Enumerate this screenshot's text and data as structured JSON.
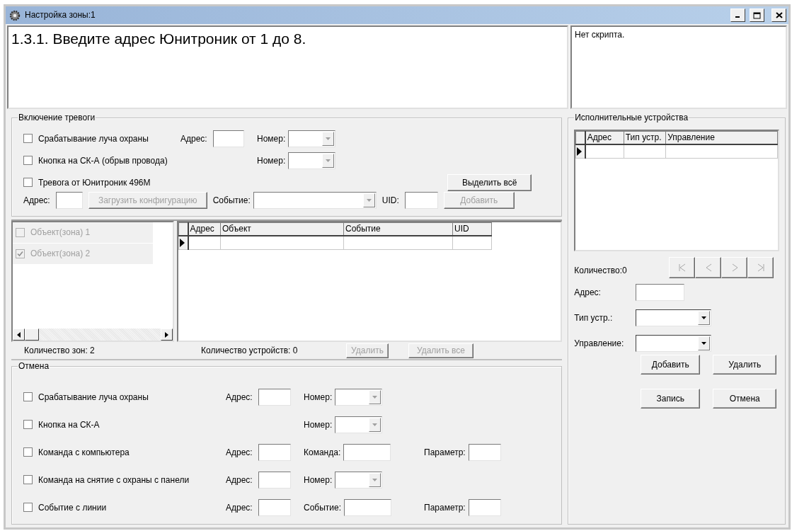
{
  "window": {
    "title": "Настройка зоны:1"
  },
  "instruction": "1.3.1. Введите адрес Юнитроник от 1 до 8.",
  "script_info": "Нет скрипта.",
  "alarm": {
    "title": "Включение тревоги",
    "rows": [
      {
        "check": {
          "label": "Срабатывание луча охраны",
          "checked": false
        },
        "address": {
          "label": "Адрес:"
        },
        "number": {
          "label": "Номер:",
          "disabled": true
        }
      },
      {
        "check": {
          "label": "Кнопка на СК-А (обрыв провода)",
          "checked": false
        },
        "number": {
          "label": "Номер:",
          "disabled": true
        }
      },
      {
        "check": {
          "label": "Тревога от Юнитроник 496М",
          "checked": false
        },
        "button": {
          "label": "Выделить всё",
          "disabled": false
        }
      }
    ],
    "source": {
      "address_label": "Адрес:",
      "load_button": {
        "label": "Загрузить конфигурацию",
        "disabled": true
      },
      "event_label": "Событие:",
      "uid_label": "UID:",
      "add_button": {
        "label": "Добавить",
        "disabled": true
      }
    }
  },
  "zones": {
    "items": [
      {
        "label": "Объект(зона) 1",
        "checked": false,
        "disabled": true
      },
      {
        "label": "Объект(зона) 2",
        "checked": true,
        "disabled": true
      }
    ]
  },
  "events_table": {
    "columns": [
      "Адрес",
      "Объект",
      "Событие",
      "UID"
    ]
  },
  "status": {
    "zones_count": "Количество зон: 2",
    "devices_count": "Количество устройств: 0",
    "buttons": [
      {
        "label": "Удалить",
        "disabled": true
      },
      {
        "label": "Удалить все",
        "disabled": true
      }
    ]
  },
  "cancel": {
    "title": "Отмена",
    "rows": [
      {
        "check": {
          "label": "Срабатывание луча охраны",
          "checked": false
        },
        "address": {
          "label": "Адрес:"
        },
        "second": {
          "kind": "combo",
          "label": "Номер:",
          "disabled": true
        }
      },
      {
        "check": {
          "label": "Кнопка на СК-А",
          "checked": false
        },
        "second": {
          "kind": "combo",
          "label": "Номер:",
          "disabled": true
        }
      },
      {
        "check": {
          "label": "Команда с компьютера",
          "checked": false
        },
        "address": {
          "label": "Адрес:"
        },
        "second": {
          "kind": "input",
          "label": "Команда:"
        },
        "third": {
          "label": "Параметр:"
        }
      },
      {
        "check": {
          "label": "Команда на снятие с охраны с панели",
          "checked": false
        },
        "address": {
          "label": "Адрес:"
        },
        "second": {
          "kind": "combo",
          "label": "Номер:",
          "disabled": true
        }
      },
      {
        "check": {
          "label": "Событие с линии",
          "checked": false
        },
        "address": {
          "label": "Адрес:"
        },
        "second": {
          "kind": "input",
          "label": "Событие:"
        },
        "third": {
          "label": "Параметр:"
        }
      }
    ]
  },
  "devices": {
    "title": "Исполнительные устройства",
    "columns": [
      "Адрес",
      "Тип устр.",
      "Управление"
    ],
    "count": "Количество:0",
    "nav_buttons": [
      {
        "kind": "first",
        "disabled": true
      },
      {
        "kind": "prev",
        "disabled": true
      },
      {
        "kind": "next",
        "disabled": true
      },
      {
        "kind": "last",
        "disabled": true
      }
    ],
    "fields": [
      {
        "kind": "input",
        "label": "Адрес:"
      },
      {
        "kind": "combo",
        "label": "Тип устр.:"
      },
      {
        "kind": "combo",
        "label": "Управление:"
      }
    ],
    "buttons": [
      {
        "label": "Добавить",
        "disabled": false
      },
      {
        "label": "Удалить",
        "disabled": false
      },
      {
        "label": "Запись",
        "disabled": false
      },
      {
        "label": "Отмена",
        "disabled": false
      }
    ]
  }
}
